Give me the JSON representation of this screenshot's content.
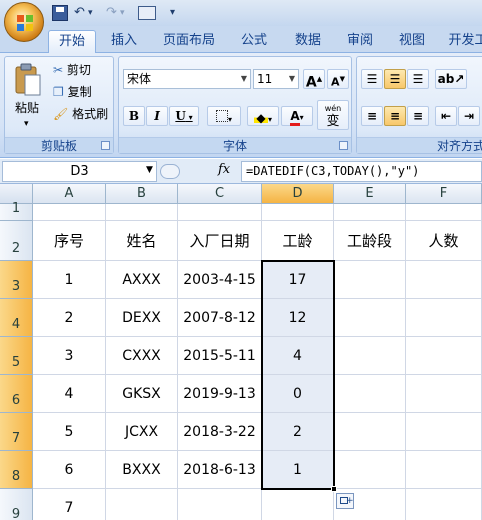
{
  "quick_access": {
    "customize": "▾"
  },
  "tabs": [
    "开始",
    "插入",
    "页面布局",
    "公式",
    "数据",
    "审阅",
    "视图",
    "开发工"
  ],
  "ribbon": {
    "clipboard": {
      "label": "剪贴板",
      "paste": "粘贴",
      "cut": "剪切",
      "copy": "复制",
      "format_painter": "格式刷"
    },
    "font": {
      "label": "字体",
      "font_name": "宋体",
      "font_size": "11",
      "grow": "A",
      "shrink": "A",
      "bold": "B",
      "italic": "I",
      "underline": "U",
      "font_color_glyph": "A",
      "phonetic": "wén",
      "phonetic_char": "变"
    },
    "alignment": {
      "label": "对齐方式"
    }
  },
  "formula_bar": {
    "name_box": "D3",
    "fx": "fx",
    "formula": "=DATEDIF(C3,TODAY(),\"y\")"
  },
  "sheet": {
    "columns": [
      "A",
      "B",
      "C",
      "D",
      "E",
      "F"
    ],
    "selected_column": "D",
    "rows": [
      {
        "num": "1",
        "cells": [
          "",
          "",
          "",
          "",
          "",
          ""
        ]
      },
      {
        "num": "2",
        "cells": [
          "序号",
          "姓名",
          "入厂日期",
          "工龄",
          "工龄段",
          "人数"
        ]
      },
      {
        "num": "3",
        "cells": [
          "1",
          "AXXX",
          "2003-4-15",
          "17",
          "",
          ""
        ]
      },
      {
        "num": "4",
        "cells": [
          "2",
          "DEXX",
          "2007-8-12",
          "12",
          "",
          ""
        ]
      },
      {
        "num": "5",
        "cells": [
          "3",
          "CXXX",
          "2015-5-11",
          "4",
          "",
          ""
        ]
      },
      {
        "num": "6",
        "cells": [
          "4",
          "GKSX",
          "2019-9-13",
          "0",
          "",
          ""
        ]
      },
      {
        "num": "7",
        "cells": [
          "5",
          "JCXX",
          "2018-3-22",
          "2",
          "",
          ""
        ]
      },
      {
        "num": "8",
        "cells": [
          "6",
          "BXXX",
          "2018-6-13",
          "1",
          "",
          ""
        ]
      },
      {
        "num": "9",
        "cells": [
          "7",
          "",
          "",
          "",
          "",
          ""
        ]
      }
    ],
    "selected_range": "D3:D8"
  }
}
